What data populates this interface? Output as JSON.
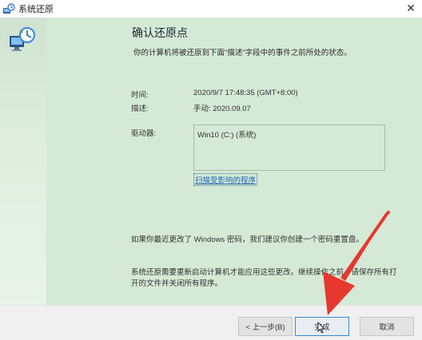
{
  "window": {
    "title": "系统还原"
  },
  "main": {
    "heading": "确认还原点",
    "subtitle": "你的计算机将被还原到下面\"描述\"字段中的事件之前所处的状态。",
    "time_label": "时间:",
    "time_value": "2020/9/7 17:48:35 (GMT+8:00)",
    "desc_label": "描述:",
    "desc_value": "手动: 2020.09.07",
    "drives_label": "驱动器:",
    "drives_value": "Win10 (C:) (系统)",
    "scan_link": "扫描受影响的程序",
    "password_notice": "如果你最近更改了 Windows 密码，我们建议你创建一个密码重置盘。",
    "restart_notice": "系统还原需要重新启动计算机才能应用这些更改。继续操作之前，请保存所有打开的文件并关闭所有程序。"
  },
  "footer": {
    "back_label": "< 上一步(B)",
    "finish_label": "完成",
    "cancel_label": "取消"
  },
  "colors": {
    "content_bg": "#d4ead6",
    "link": "#1f63b5",
    "annotation_arrow": "#e8372e",
    "focus_border": "#2f8ed8"
  },
  "icons": {
    "title": "system-restore-icon",
    "sidebar": "system-restore-computer-icon",
    "close": "close-icon"
  }
}
